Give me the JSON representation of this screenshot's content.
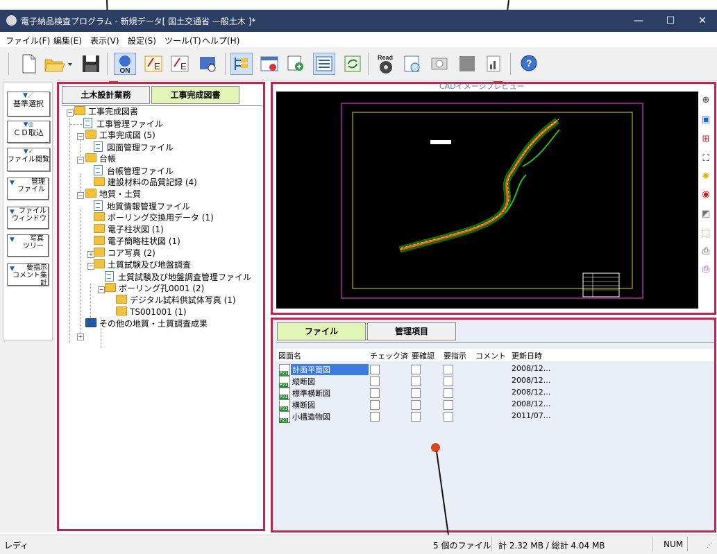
{
  "window": {
    "title": "電子納品検査プログラム - 新規データ[ 国土交通省 一般土木 ]*",
    "minimize": "—",
    "maximize": "☐",
    "close": "✕"
  },
  "menu": [
    "ファイル(F)",
    "編集(E)",
    "表示(V)",
    "設定(S)",
    "ツール(T)",
    "ヘルプ(H)"
  ],
  "toolbar": {
    "read_label": "Read",
    "on_label": "ON",
    "icons": [
      "new-file",
      "open-folder",
      "save",
      "on-toggle",
      "export-e1",
      "export-e2",
      "search-doc",
      "tree-view",
      "cad-view",
      "photo-add",
      "list-view",
      "refresh",
      "read-cd",
      "preview",
      "cd-drive",
      "blank",
      "report",
      "help"
    ]
  },
  "left_buttons": [
    {
      "label": "基準選択"
    },
    {
      "label": "ＣＤ取込"
    },
    {
      "label": "ファイル閲覧"
    },
    {
      "label": "管理\nファイル"
    },
    {
      "label": "ファイル\nウィンドウ"
    },
    {
      "label": "写真\nツリー"
    },
    {
      "label": "要指示\nコメント集計"
    }
  ],
  "tree": {
    "tabs": [
      "土木設計業務",
      "工事完成図書"
    ],
    "active_tab": 1,
    "nodes": [
      {
        "label": "工事完成図書",
        "icon": "folder"
      },
      {
        "label": "工事管理ファイル",
        "icon": "doc"
      },
      {
        "label": "工事完成図 (5)",
        "icon": "folder"
      },
      {
        "label": "図面管理ファイル",
        "icon": "doc"
      },
      {
        "label": "台帳",
        "icon": "folder"
      },
      {
        "label": "台帳管理ファイル",
        "icon": "doc"
      },
      {
        "label": "建設材料の品質記録 (4)",
        "icon": "folder"
      },
      {
        "label": "地質・土質",
        "icon": "folder"
      },
      {
        "label": "地質情報管理ファイル",
        "icon": "doc"
      },
      {
        "label": "ボーリング交換用データ (1)",
        "icon": "folder"
      },
      {
        "label": "電子柱状図 (1)",
        "icon": "folder"
      },
      {
        "label": "電子簡略柱状図 (1)",
        "icon": "folder"
      },
      {
        "label": "コア写真 (2)",
        "icon": "folder"
      },
      {
        "label": "土質試験及び地盤調査",
        "icon": "folder"
      },
      {
        "label": "土質試験及び地盤調査管理ファイル",
        "icon": "doc"
      },
      {
        "label": "ボーリング孔0001 (2)",
        "icon": "folder"
      },
      {
        "label": "デジタル試料供試体写真 (1)",
        "icon": "folder"
      },
      {
        "label": "TS001001 (1)",
        "icon": "folder"
      },
      {
        "label": "その他の地質・土質調査成果",
        "icon": "folder-blue"
      }
    ]
  },
  "preview": {
    "title": "CADイメージプレビュー",
    "tools": [
      "zoom-icon",
      "window-icon",
      "move-icon",
      "fit-icon",
      "bulb-icon",
      "color-icon",
      "contrast-icon",
      "layer-icon",
      "print-icon",
      "print-setup-icon"
    ]
  },
  "files": {
    "tabs": [
      "ファイル",
      "管理項目"
    ],
    "active_tab": 0,
    "columns": [
      "図面名",
      "チェック済",
      "要確認",
      "要指示",
      "コメント",
      "更新日時"
    ],
    "rows": [
      {
        "name": "計画平面図",
        "date": "2008/12...",
        "selected": true
      },
      {
        "name": "縦断図",
        "date": "2008/12..."
      },
      {
        "name": "標準横断図",
        "date": "2008/12..."
      },
      {
        "name": "横断図",
        "date": "2008/12..."
      },
      {
        "name": "小構造物図",
        "date": "2011/07..."
      }
    ]
  },
  "status": {
    "ready": "レディ",
    "file_count": "5 個のファイル",
    "size": "計 2.32 MB / 総計 4.04 MB",
    "num": "NUM"
  },
  "colors": {
    "titlebar": "#2b3e63",
    "panel_border": "#c8224a",
    "tab_active": "#e2f5b6",
    "selection": "#3b7be0",
    "annotation": "#e0441b"
  }
}
